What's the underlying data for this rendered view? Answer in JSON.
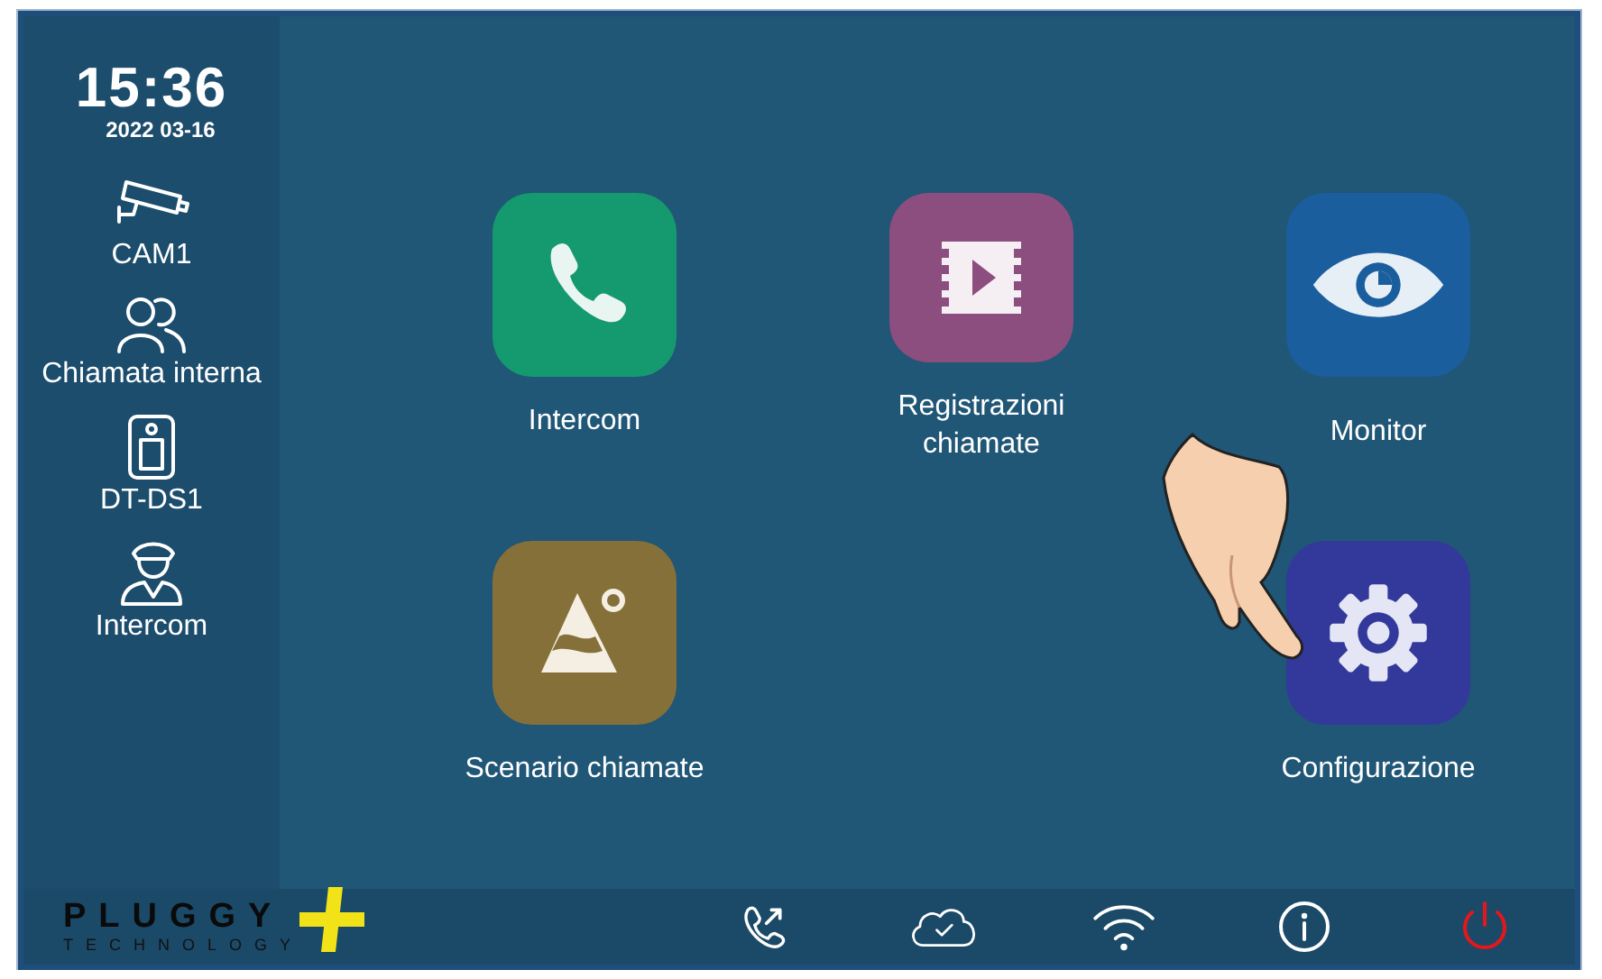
{
  "clock": {
    "time": "15:36",
    "date": "2022 03-16"
  },
  "sidebar": {
    "items": [
      {
        "kind": "camera",
        "label": "CAM1"
      },
      {
        "kind": "people",
        "label": "Chiamata interna"
      },
      {
        "kind": "door-station",
        "label": "DT-DS1"
      },
      {
        "kind": "guard",
        "label": "Intercom"
      }
    ]
  },
  "apps": [
    {
      "kind": "phone",
      "label": "Intercom",
      "color": "#149a6e"
    },
    {
      "kind": "video",
      "label": "Registrazioni chiamate",
      "color": "#8c4e7e"
    },
    {
      "kind": "eye",
      "label": "Monitor",
      "color": "#1b5e9e"
    },
    {
      "kind": "mountain",
      "label": "Scenario chiamate",
      "color": "#86703a"
    },
    {
      "kind": "gear",
      "label": "Configurazione",
      "color": "#33399a"
    }
  ],
  "status_bar": {
    "brand": "PLUGGY",
    "brand_sub": "TECHNOLOGY"
  }
}
